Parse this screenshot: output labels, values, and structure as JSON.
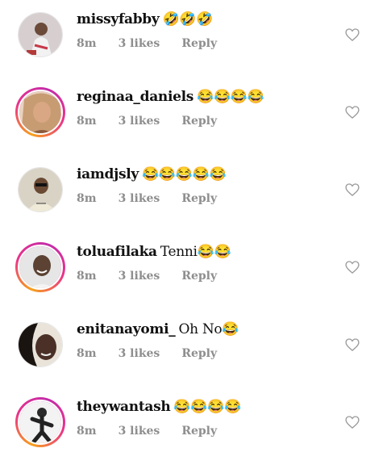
{
  "comments": [
    {
      "username": "missyfabby",
      "text": "🤣🤣🤣",
      "time": "8m",
      "likes": "3 likes",
      "reply": "Reply",
      "story_ring": false,
      "avatar_color": "#c9b7b7"
    },
    {
      "username": "reginaa_daniels",
      "text": "😂😂😂😂",
      "time": "8m",
      "likes": "3 likes",
      "reply": "Reply",
      "story_ring": true,
      "avatar_color": "#b78563"
    },
    {
      "username": "iamdjsly",
      "text": "😂😂😂😂😂",
      "time": "8m",
      "likes": "3 likes",
      "reply": "Reply",
      "story_ring": false,
      "avatar_color": "#8a6f57"
    },
    {
      "username": "toluafilaka",
      "text": "Tenni😂😂",
      "time": "8m",
      "likes": "3 likes",
      "reply": "Reply",
      "story_ring": true,
      "avatar_color": "#7a6a5c"
    },
    {
      "username": "enitanayomi_",
      "text": "Oh No😂",
      "time": "8m",
      "likes": "3 likes",
      "reply": "Reply",
      "story_ring": false,
      "avatar_color": "#3a2a22"
    },
    {
      "username": "theywantash",
      "text": "😂😂😂😂",
      "time": "8m",
      "likes": "3 likes",
      "reply": "Reply",
      "story_ring": true,
      "avatar_color": "#2b2b2b"
    }
  ]
}
